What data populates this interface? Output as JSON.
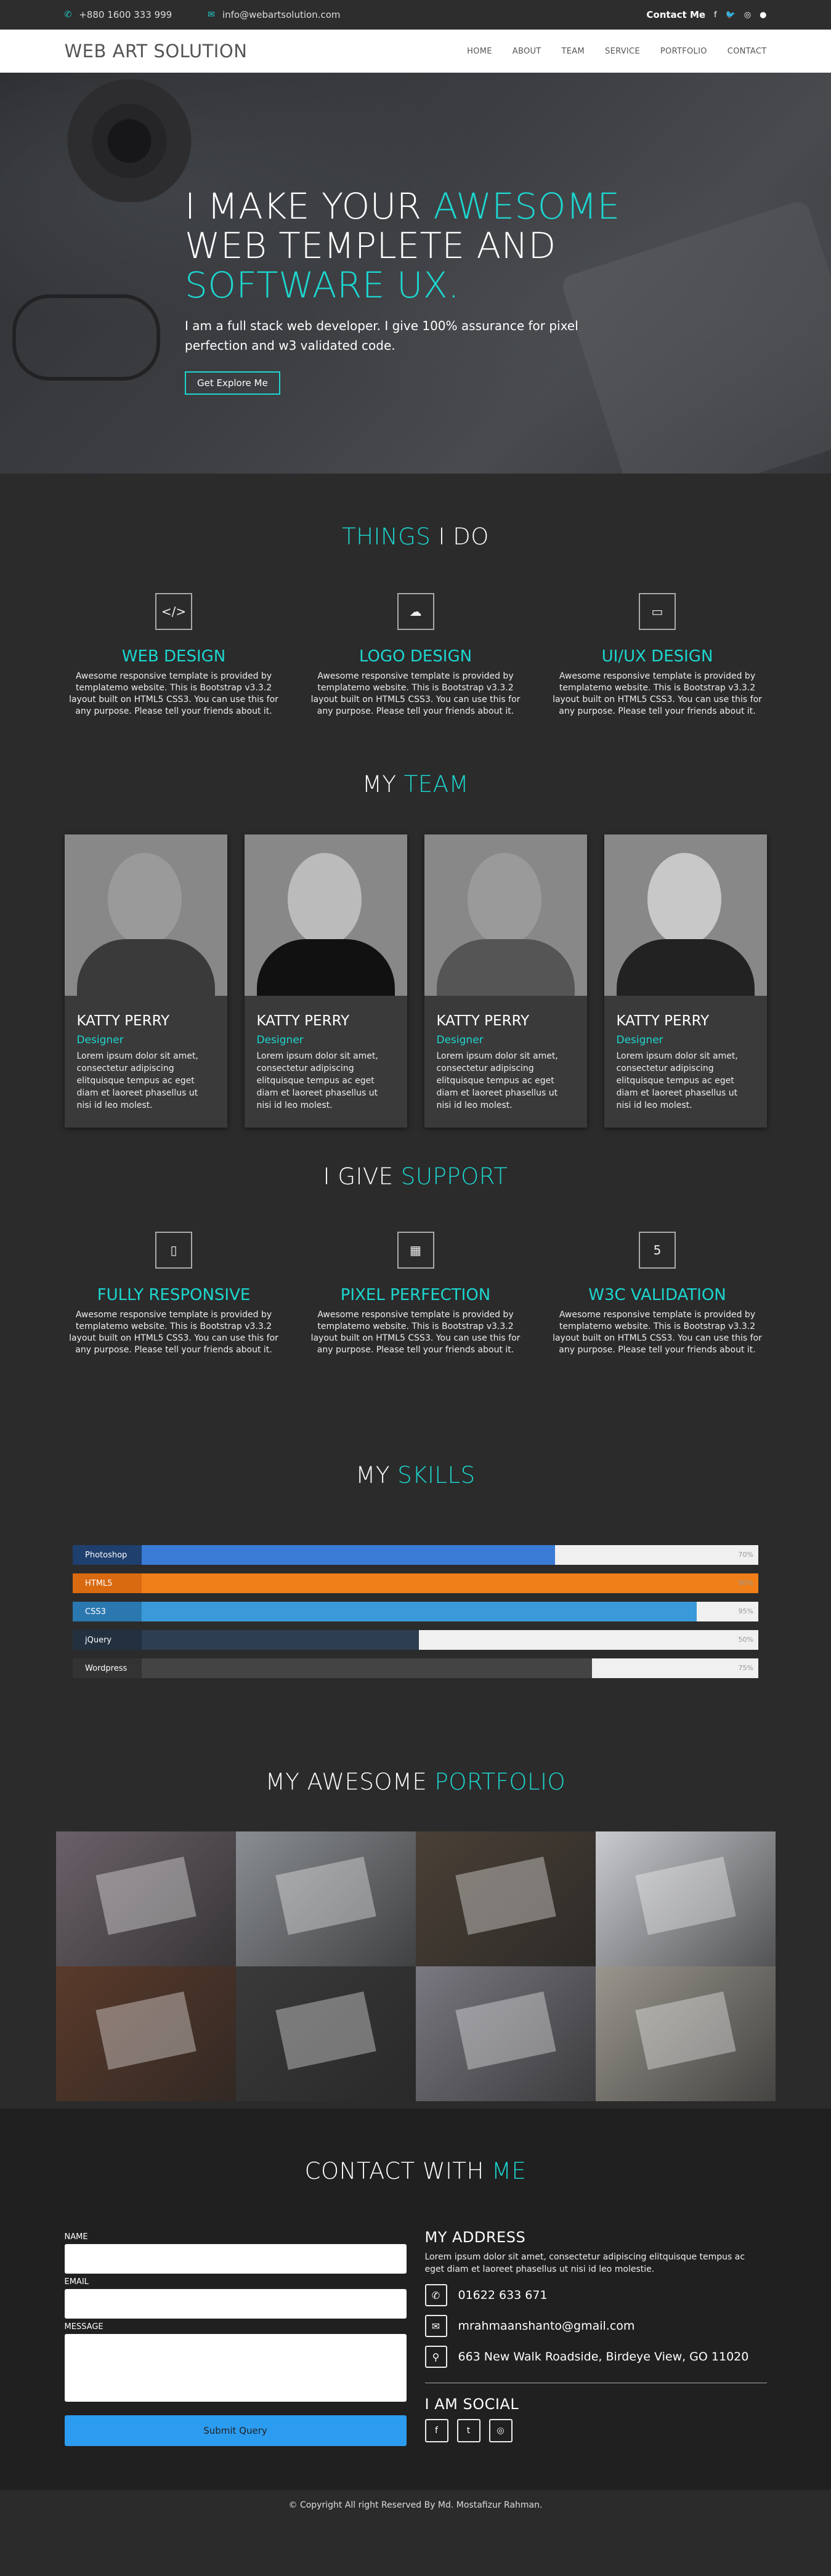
{
  "topbar": {
    "phone": "+880 1600 333 999",
    "email": "info@webartsolution.com",
    "contact_label": "Contact Me",
    "social_icons": [
      "facebook-icon",
      "twitter-icon",
      "instagram-icon",
      "apple-icon"
    ]
  },
  "nav": {
    "brand": "WEB ART SOLUTION",
    "items": [
      "HOME",
      "ABOUT",
      "TEAM",
      "SERVICE",
      "PORTFOLIO",
      "CONTACT"
    ]
  },
  "hero": {
    "line1_a": "I MAKE YOUR ",
    "line1_b": "AWESOME",
    "line2": "WEB TEMPLETE AND",
    "line3": "SOFTWARE UX.",
    "paragraph": "I am a full stack web developer. I give 100% assurance for pixel perfection and w3 validated code.",
    "button": "Get Explore Me"
  },
  "things": {
    "title_a": "THINGS",
    "title_b": " I DO",
    "items": [
      {
        "icon": "code-icon",
        "title": "WEB DESIGN",
        "text": "Awesome responsive template is provided by templatemo website. This is Bootstrap v3.3.2 layout built on HTML5 CSS3. You can use this for any purpose. Please tell your friends about it."
      },
      {
        "icon": "cloud-icon",
        "title": "LOGO DESIGN",
        "text": "Awesome responsive template is provided by templatemo website. This is Bootstrap v3.3.2 layout built on HTML5 CSS3. You can use this for any purpose. Please tell your friends about it."
      },
      {
        "icon": "laptop-icon",
        "title": "UI/UX DESIGN",
        "text": "Awesome responsive template is provided by templatemo website. This is Bootstrap v3.3.2 layout built on HTML5 CSS3. You can use this for any purpose. Please tell your friends about it."
      }
    ]
  },
  "team": {
    "title_a": "MY ",
    "title_b": "TEAM",
    "members": [
      {
        "name": "KATTY PERRY",
        "role": "Designer",
        "text": "Lorem ipsum dolor sit amet, consectetur adipiscing elitquisque tempus ac eget diam et laoreet phasellus ut nisi id leo molest."
      },
      {
        "name": "KATTY PERRY",
        "role": "Designer",
        "text": "Lorem ipsum dolor sit amet, consectetur adipiscing elitquisque tempus ac eget diam et laoreet phasellus ut nisi id leo molest."
      },
      {
        "name": "KATTY PERRY",
        "role": "Designer",
        "text": "Lorem ipsum dolor sit amet, consectetur adipiscing elitquisque tempus ac eget diam et laoreet phasellus ut nisi id leo molest."
      },
      {
        "name": "KATTY PERRY",
        "role": "Designer",
        "text": "Lorem ipsum dolor sit amet, consectetur adipiscing elitquisque tempus ac eget diam et laoreet phasellus ut nisi id leo molest."
      }
    ]
  },
  "support": {
    "title_a": "I GIVE ",
    "title_b": "SUPPORT",
    "items": [
      {
        "icon": "mobile-icon",
        "title": "FULLY RESPONSIVE",
        "text": "Awesome responsive template is provided by templatemo website. This is Bootstrap v3.3.2 layout built on HTML5 CSS3. You can use this for any purpose. Please tell your friends about it."
      },
      {
        "icon": "grid-icon",
        "title": "PIXEL PERFECTION",
        "text": "Awesome responsive template is provided by templatemo website. This is Bootstrap v3.3.2 layout built on HTML5 CSS3. You can use this for any purpose. Please tell your friends about it."
      },
      {
        "icon": "html5-icon",
        "title": "W3C VALIDATION",
        "text": "Awesome responsive template is provided by templatemo website. This is Bootstrap v3.3.2 layout built on HTML5 CSS3. You can use this for any purpose. Please tell your friends about it."
      }
    ]
  },
  "skills": {
    "title_a": "MY ",
    "title_b": "SKILLS",
    "items": [
      {
        "name": "Photoshop",
        "percent": 67,
        "pct_label": "70%",
        "color": "#3a7bd5",
        "label_bg": "#1f3f6e"
      },
      {
        "name": "HTML5",
        "percent": 100,
        "pct_label": "90%",
        "color": "#f07f1a",
        "label_bg": "#d96a10"
      },
      {
        "name": "CSS3",
        "percent": 90,
        "pct_label": "95%",
        "color": "#3a9ad9",
        "label_bg": "#2b78b0"
      },
      {
        "name": "jQuery",
        "percent": 45,
        "pct_label": "50%",
        "color": "#2d3e50",
        "label_bg": "#223040"
      },
      {
        "name": "Wordpress",
        "percent": 73,
        "pct_label": "75%",
        "color": "#444444",
        "label_bg": "#333333"
      }
    ]
  },
  "portfolio": {
    "title_a": "MY AWESOME ",
    "title_b": "PORTFOLIO",
    "tiles": [
      "#6a6168",
      "#8a8e92",
      "#4a4036",
      "#c9cbd0",
      "#5a3a2a",
      "#3a3a3a",
      "#7a7880",
      "#9a968e"
    ]
  },
  "contact": {
    "title_a": "CONTACT WITH ",
    "title_b": "ME",
    "name_label": "NAME",
    "email_label": "EMAIL",
    "message_label": "MESSAGE",
    "submit": "Submit Query",
    "address_title": "MY ADDRESS",
    "address_text": "Lorem ipsum dolor sit amet, consectetur adipiscing elitquisque tempus ac eget diam et laoreet phasellus ut nisi id leo molestie.",
    "phone": "01622 633 671",
    "mail": "mrahmaanshanto@gmail.com",
    "location": "663 New Walk Roadside, Birdeye View, GO 11020",
    "social_title": "I AM SOCIAL"
  },
  "footer": {
    "text": "© Copyright All right Reserved By Md. Mostafizur Rahman."
  }
}
